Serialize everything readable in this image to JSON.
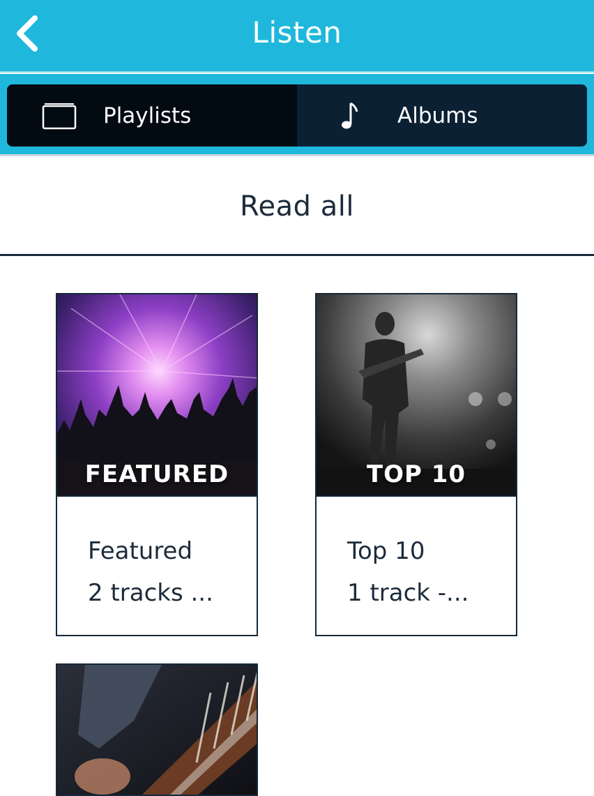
{
  "header": {
    "title": "Listen",
    "back_icon": "chevron-left-icon",
    "background_color": "#1fb8dc"
  },
  "tabs": [
    {
      "label": "Playlists",
      "icon": "playlist-folder-icon",
      "active": true
    },
    {
      "label": "Albums",
      "icon": "music-note-icon",
      "active": false
    }
  ],
  "read_all": {
    "label": "Read all"
  },
  "playlists": [
    {
      "title": "Featured",
      "subtitle": "2 tracks ...",
      "cover_text": "FEATURED"
    },
    {
      "title": "Top 10",
      "subtitle": "1 track -...",
      "cover_text": "TOP 10"
    },
    {
      "title": "",
      "subtitle": "",
      "cover_text": ""
    }
  ]
}
